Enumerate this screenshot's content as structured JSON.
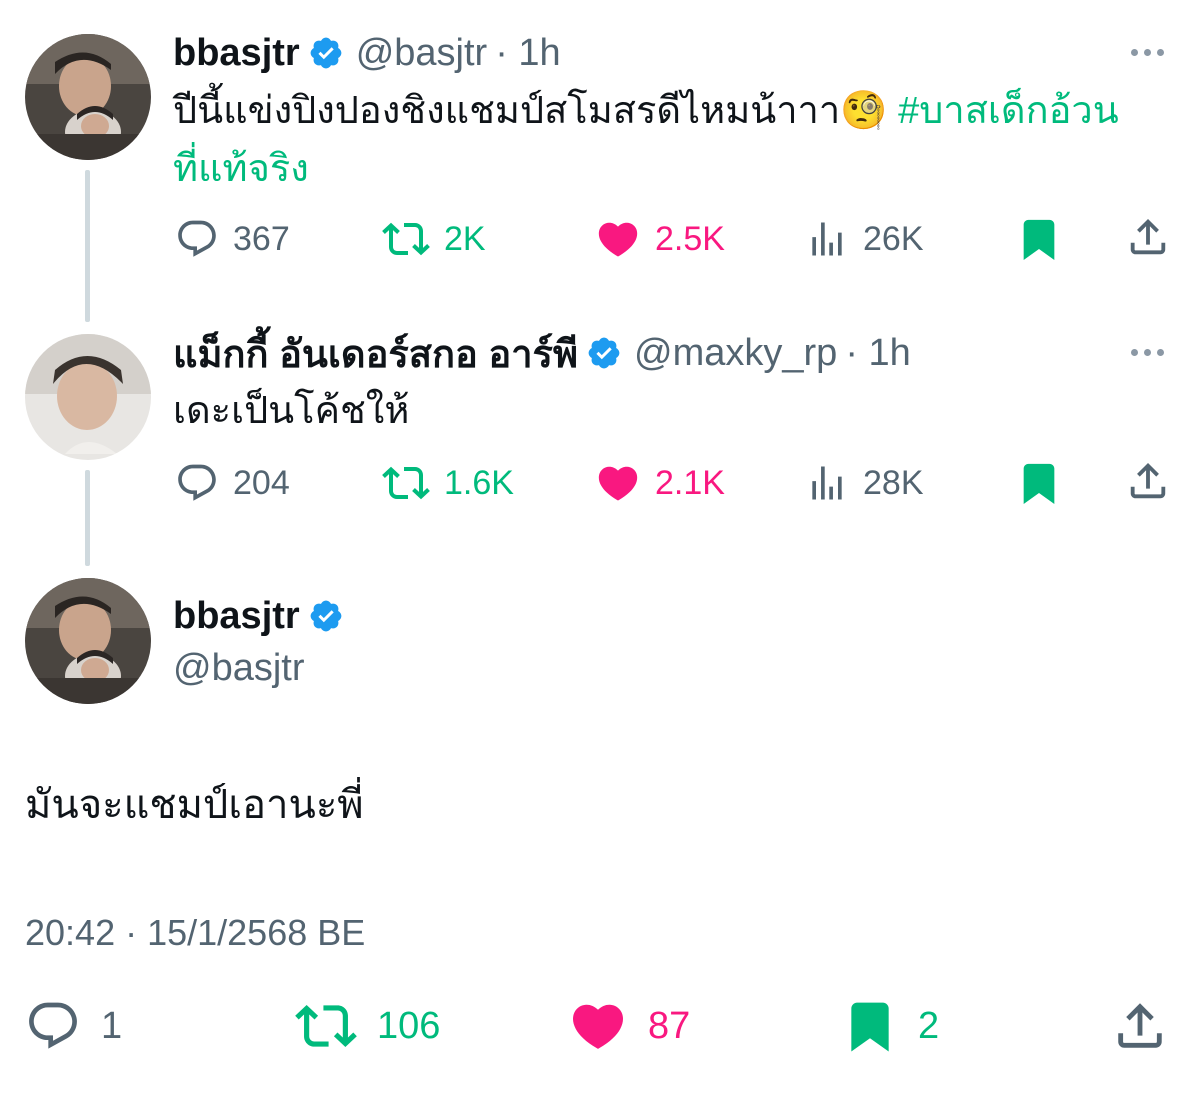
{
  "theme": {
    "accent_green": "#00ba7c",
    "like_pink": "#f91880",
    "verified_blue": "#1d9bf0",
    "secondary_text": "#536471"
  },
  "tweets": [
    {
      "display_name": "bbasjtr",
      "handle": "@basjtr",
      "time": "· 1h",
      "text": "ปีนี้แข่งปิงปองชิงแชมป์สโมสรดีไหมน้าาา",
      "emoji": "🧐",
      "hashtag_part1": "#บาสเด็กอ้วน",
      "hashtag_part2": "ที่แท้จริง",
      "replies": "367",
      "retweets": "2K",
      "likes": "2.5K",
      "views": "26K"
    },
    {
      "display_name": "แม็กกี้ อันเดอร์สกอ อาร์พี",
      "handle": "@maxky_rp",
      "time": "· 1h",
      "text": "เดะเป็นโค้ชให้",
      "replies": "204",
      "retweets": "1.6K",
      "likes": "2.1K",
      "views": "28K"
    }
  ],
  "main_tweet": {
    "display_name": "bbasjtr",
    "handle": "@basjtr",
    "text": "มันจะแชมป์เอานะพี่",
    "timestamp": "20:42 · 15/1/2568 BE",
    "replies": "1",
    "retweets": "106",
    "likes": "87",
    "bookmarks": "2"
  },
  "icons": {
    "verified": "verified-badge-icon",
    "reply": "reply-icon",
    "retweet": "retweet-icon",
    "like": "heart-icon",
    "views": "views-chart-icon",
    "bookmark": "bookmark-icon",
    "share": "share-icon",
    "more": "more-dots-icon"
  }
}
